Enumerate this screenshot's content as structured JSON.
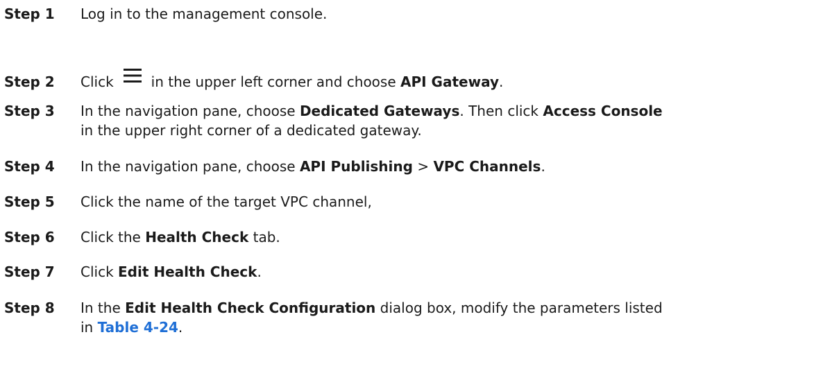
{
  "steps": [
    {
      "label": "Step 1",
      "t1": "Log in to the management console."
    },
    {
      "label": "Step 2",
      "t1": "Click",
      "icon": "hamburger-menu-icon",
      "t2": "in the upper left corner and choose ",
      "b1": "API Gateway",
      "t3": "."
    },
    {
      "label": "Step 3",
      "t1": "In the navigation pane, choose ",
      "b1": "Dedicated Gateways",
      "t2": ". Then click ",
      "b2": "Access Console",
      "line2": "in the upper right corner of a dedicated gateway."
    },
    {
      "label": "Step 4",
      "t1": "In the navigation pane, choose ",
      "b1": "API Publishing",
      "t2": " > ",
      "b2": "VPC Channels",
      "t3": "."
    },
    {
      "label": "Step 5",
      "t1": "Click the name of the target VPC channel,"
    },
    {
      "label": "Step 6",
      "t1": "Click the ",
      "b1": "Health Check",
      "t2": " tab."
    },
    {
      "label": "Step 7",
      "t1": "Click ",
      "b1": "Edit Health Check",
      "t2": "."
    },
    {
      "label": "Step 8",
      "t1": "In the ",
      "b1": "Edit Health Check Configuration",
      "t2": " dialog box, modify the parameters listed",
      "line2a": "in ",
      "link": "Table 4-24",
      "line2b": "."
    }
  ]
}
